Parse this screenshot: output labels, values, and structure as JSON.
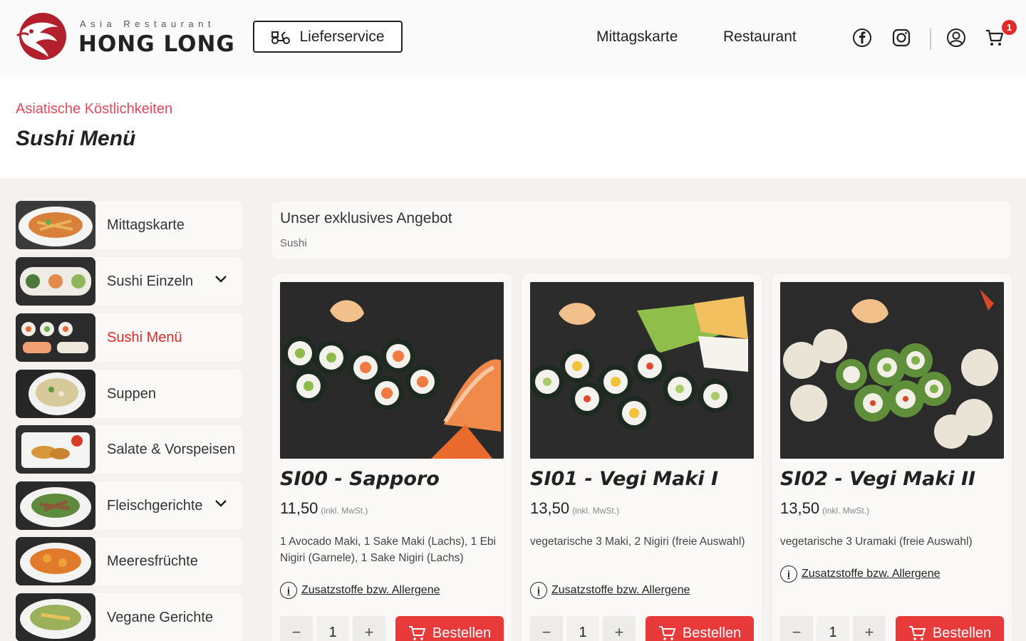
{
  "header": {
    "logo_subtitle": "Asia Restaurant",
    "logo_name": "HONG LONG",
    "delivery_label": "Lieferservice",
    "nav": [
      "Mittagskarte",
      "Restaurant"
    ],
    "cart_count": "1"
  },
  "page": {
    "eyebrow": "Asiatische Köstlichkeiten",
    "title": "Sushi Menü"
  },
  "sidebar": {
    "items": [
      {
        "label": "Mittagskarte"
      },
      {
        "label": "Sushi Einzeln"
      },
      {
        "label": "Sushi Menü"
      },
      {
        "label": "Suppen"
      },
      {
        "label": "Salate & Vorspeisen"
      },
      {
        "label": "Fleischgerichte"
      },
      {
        "label": "Meeresfrüchte"
      },
      {
        "label": "Vegane Gerichte"
      }
    ]
  },
  "offer": {
    "title": "Unser exklusives Angebot",
    "subtitle": "Sushi"
  },
  "products": [
    {
      "title": "SI00 - Sapporo",
      "price": "11,50",
      "tax_note": "(inkl. MwSt.)",
      "description": "1 Avocado Maki, 1 Sake Maki (Lachs), 1 Ebi Nigiri (Garnele), 1 Sake Nigiri (Lachs)",
      "allergen_label": "Zusatzstoffe bzw. Allergene",
      "qty_minus": "−",
      "qty": "1",
      "qty_plus": "+",
      "order_label": "Bestellen"
    },
    {
      "title": "SI01 - Vegi Maki I",
      "price": "13,50",
      "tax_note": "(inkl. MwSt.)",
      "description": "vegetarische 3 Maki, 2 Nigiri (freie Auswahl)",
      "allergen_label": "Zusatzstoffe bzw. Allergene",
      "qty_minus": "−",
      "qty": "1",
      "qty_plus": "+",
      "order_label": "Bestellen"
    },
    {
      "title": "SI02 - Vegi Maki II",
      "price": "13,50",
      "tax_note": "(inkl. MwSt.)",
      "description": "vegetarische 3 Uramaki (freie Auswahl)",
      "allergen_label": "Zusatzstoffe bzw. Allergene",
      "qty_minus": "−",
      "qty": "1",
      "qty_plus": "+",
      "order_label": "Bestellen"
    }
  ],
  "colors": {
    "accent": "#e83a3a",
    "eyebrow": "#e8475a",
    "background": "#f4f1ef"
  }
}
